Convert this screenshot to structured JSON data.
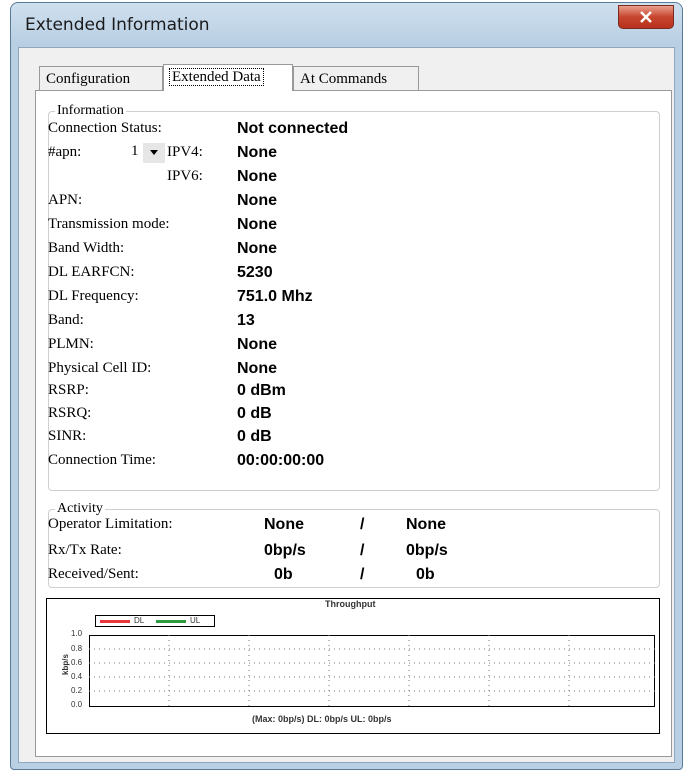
{
  "window": {
    "title": "Extended Information"
  },
  "tabs": [
    {
      "label": "Configuration"
    },
    {
      "label": "Extended Data"
    },
    {
      "label": "At Commands"
    }
  ],
  "information": {
    "title": "Information",
    "rows": [
      {
        "label": "Connection Status:",
        "value": "Not connected"
      },
      {
        "label": "#apn:",
        "value": "None"
      },
      {
        "label": "IPV4:",
        "value": "None"
      },
      {
        "label": "IPV6:",
        "value": "None"
      },
      {
        "label": "APN:",
        "value": "None"
      },
      {
        "label": "Transmission mode:",
        "value": "None"
      },
      {
        "label": "Band Width:",
        "value": "None"
      },
      {
        "label": "DL EARFCN:",
        "value": "5230"
      },
      {
        "label": "DL Frequency:",
        "value": "751.0 Mhz"
      },
      {
        "label": "Band:",
        "value": "13"
      },
      {
        "label": "PLMN:",
        "value": "None"
      },
      {
        "label": "Physical Cell ID:",
        "value": "None"
      },
      {
        "label": "RSRP:",
        "value": "0 dBm"
      },
      {
        "label": "RSRQ:",
        "value": "0 dB"
      },
      {
        "label": "SINR:",
        "value": "0 dB"
      },
      {
        "label": "Connection Time:",
        "value": "00:00:00:00"
      }
    ],
    "apn_selected": "1"
  },
  "activity": {
    "title": "Activity",
    "rows": [
      {
        "label": "Operator Limitation:",
        "left": "None",
        "sep": "/",
        "right": "None"
      },
      {
        "label": "Rx/Tx Rate:",
        "left": "0bp/s",
        "sep": "/",
        "right": "0bp/s"
      },
      {
        "label": "Received/Sent:",
        "left": "0b",
        "sep": "/",
        "right": "0b"
      }
    ]
  },
  "throughput": {
    "title": "Throughput",
    "caption": "(Max: 0bp/s) DL: 0bp/s UL: 0bp/s",
    "ylabel": "kbp/s",
    "legend": [
      "DL",
      "UL"
    ],
    "yticks": [
      "1.0",
      "0.8",
      "0.6",
      "0.4",
      "0.2",
      "0.0"
    ],
    "colors": {
      "dl": "#e8363c",
      "ul": "#2e9a3f"
    }
  }
}
